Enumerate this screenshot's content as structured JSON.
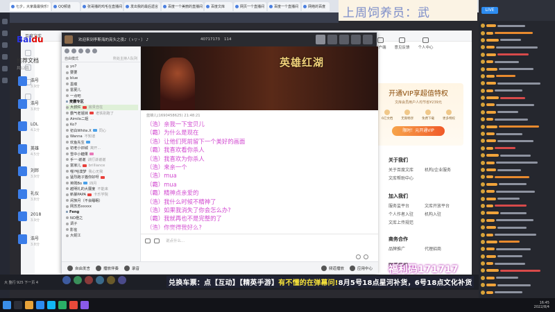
{
  "browser_tabs": [
    "七夕，大家最最快乐!",
    "QQ频道",
    "张哥播的鸡毛在直播间",
    "发出我的最后遗言",
    "百度一个美丽的直播间",
    "百度文库",
    "网页一个直播间",
    "百度一个直播间",
    "网络的百度"
  ],
  "stream_cover_title": "上周饲养员：武",
  "baidu": {
    "logo_a": "Bai",
    "logo_b": "du",
    "top_actions": [
      "客户端",
      "意见反馈",
      "个人中心"
    ],
    "doc_title": "推荐文档",
    "doc_sub": "共12篇",
    "docs": [
      {
        "title": "浩号",
        "meta": "3.9分"
      },
      {
        "title": "浩号",
        "meta": "3.8分"
      },
      {
        "title": "LOL",
        "meta": "4.1分"
      },
      {
        "title": "英雄",
        "meta": "4.5分"
      },
      {
        "title": "刘邦",
        "meta": "3.9分"
      },
      {
        "title": "礼仪",
        "meta": "3.8分"
      },
      {
        "title": "2018",
        "meta": "3.9分"
      },
      {
        "title": "浩号",
        "meta": "3.8分"
      }
    ],
    "vip": {
      "title": "开通VIP享超值特权",
      "subtitle": "文库会员用户人均节省¥239元",
      "perks": [
        "6亿文档",
        "无限畅享",
        "免费下载",
        "更多特权"
      ],
      "button": "限时！元开通VIP"
    },
    "sections": [
      {
        "title": "关于我们",
        "links": [
          "关于百度文库",
          "机构/企业服务",
          "文库帮助中心"
        ]
      },
      {
        "title": "加入我们",
        "links": [
          "服务监平台",
          "文库开放平台",
          "个人作者入驻",
          "机构入驻",
          "文库上传规范"
        ]
      },
      {
        "title": "商务合作",
        "links": [
          "品牌推广",
          "代理招商"
        ]
      },
      {
        "title": "联系我们",
        "links": []
      }
    ]
  },
  "qq": {
    "title": "欢迎来到李斯海的亮头之夜♪（ゝ▽・） ♪",
    "id": "40717173",
    "members": "114",
    "mode_label": "自由模式",
    "mode_right": "所处主持人队列",
    "users": [
      {
        "name": "yo7",
        "badge": ""
      },
      {
        "name": "要要",
        "badge": ""
      },
      {
        "name": "blue",
        "badge": ""
      },
      {
        "name": "墨痕",
        "badge": ""
      },
      {
        "name": "雷夏儿",
        "badge": ""
      },
      {
        "name": "一点吧",
        "badge": ""
      },
      {
        "name": "麦霸专区",
        "badge": "",
        "group": true
      },
      {
        "name": "大叔红",
        "badge": "red",
        "extra": "房贵自在",
        "hl": true
      },
      {
        "name": "霸气老姐妹",
        "badge": "red",
        "extra": "老铁别跑了"
      },
      {
        "name": "Aimilo二姐",
        "badge": "",
        "extra": "..."
      },
      {
        "name": "Ko7",
        "badge": "",
        "extra": ""
      },
      {
        "name": "初白White.X",
        "badge": "blue",
        "extra": "同心"
      },
      {
        "name": "Wanna",
        "badge": "",
        "extra": "不知道"
      },
      {
        "name": "欢鱼先生",
        "badge": "blue",
        "extra": ""
      },
      {
        "name": "初老小旧城",
        "badge": "",
        "extra": "离开..."
      },
      {
        "name": "雪中小糖果",
        "badge": "pink",
        "extra": ""
      },
      {
        "name": "手一·谢谢",
        "badge": "",
        "extra": "讲打讲谢谢"
      },
      {
        "name": "富家儿",
        "badge": "red",
        "extra": "brilliance"
      },
      {
        "name": "喵?哈漠梦",
        "badge": "",
        "extra": "我心无我"
      },
      {
        "name": "猛烈跑子猫你好呀",
        "badge": "red",
        "extra": ""
      },
      {
        "name": "英贱Bo",
        "badge": "blue",
        "extra": "四月"
      },
      {
        "name": "越明礼的大厦度",
        "badge": "",
        "extra": "不能来"
      },
      {
        "name": "新暴PAPA",
        "badge": "red",
        "extra": "卡乐学院"
      },
      {
        "name": "闲族月（不会睡眠）",
        "badge": "",
        "extra": ""
      },
      {
        "name": "网苏苏xxxxx",
        "badge": "",
        "extra": ""
      },
      {
        "name": "Feng",
        "badge": "",
        "group": true
      },
      {
        "name": "NO橙之",
        "badge": ""
      },
      {
        "name": "调子",
        "badge": ""
      },
      {
        "name": "影雀",
        "badge": ""
      },
      {
        "name": "大妮江",
        "badge": ""
      }
    ],
    "banner_logo": "英雄红湖",
    "chat_head": "蓝锦儿(1690458625)  21:48:21",
    "messages": [
      "（浩）亲我一下宝贝儿",
      "（霸）为什么是现在",
      "（浩）让他们死前留下一个美好的画面",
      "（霸）我喜欢看你杀人",
      "（浩）我喜欢为你杀人",
      "（浩）来亲一个",
      "（浩）mua",
      "（霸）mua",
      "（霸）精神点亲爱的",
      "（浩）我什么时候不精神了",
      "（浩）如果我消失了你会怎么办?",
      "（霸）我就再也不是完整的了",
      "（浩）你觉得我好么?"
    ],
    "input_placeholder": "说点什么...",
    "bottom": [
      "自由发言",
      "播放伴奏",
      "录音"
    ],
    "bottom_right": [
      "频道播放",
      "应用中心"
    ]
  },
  "overlay": {
    "marquee_prefix": "兑换车票：点【互动】【精英手游】",
    "marquee_mid": "有不懂的在弹幕问!",
    "marquee_suffix": "8月5号18点星河补货，6号18点文化补货",
    "fuli": "福利码171717",
    "pager": "大 整行  925 下一页 4"
  },
  "taskbar": {
    "time": "16:45",
    "date": "2022/8/4"
  },
  "colors": {
    "chat_pink": "#d24bd0",
    "baidu_blue": "#2932e1",
    "baidu_red": "#e10601",
    "marquee_yellow": "#f6e23a"
  }
}
